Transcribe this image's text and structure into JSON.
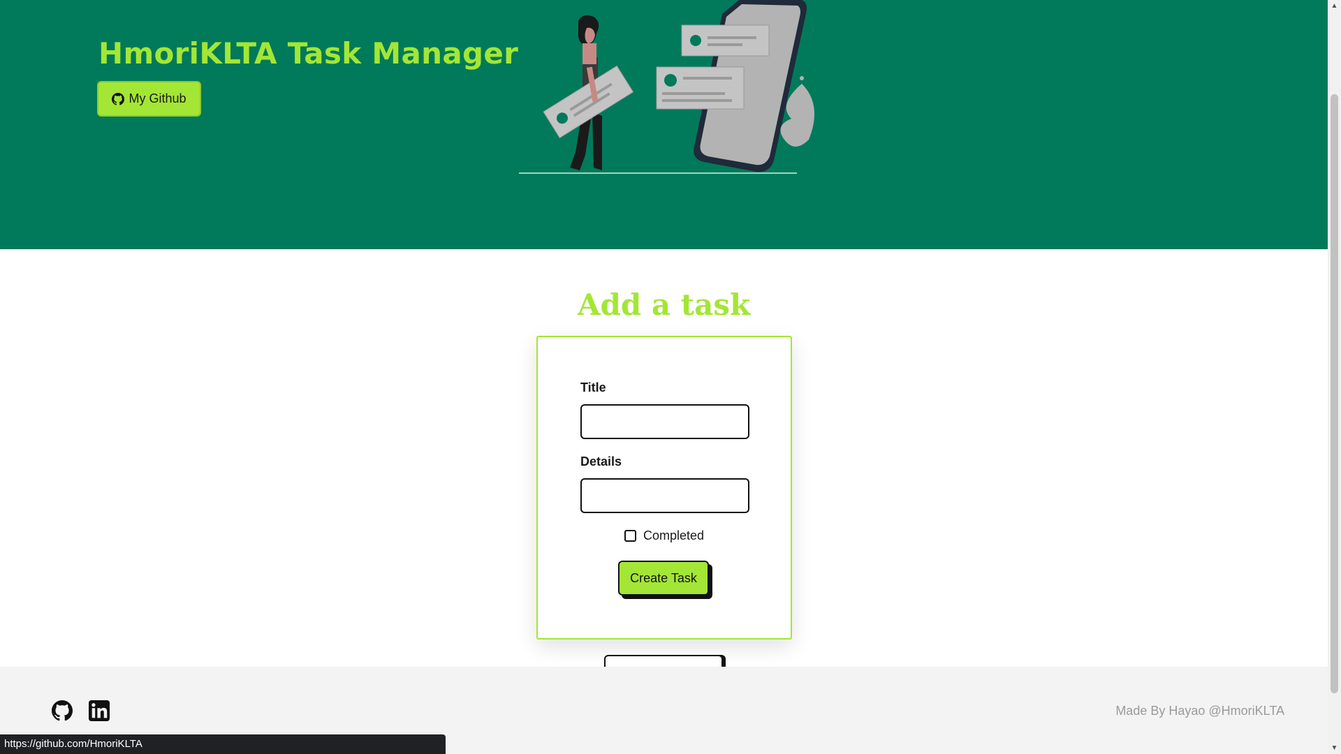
{
  "header": {
    "title": "HmoriKLTA Task Manager",
    "github_button_label": "My Github"
  },
  "form": {
    "section_title": "Add a task",
    "title_label": "Title",
    "title_value": "",
    "details_label": "Details",
    "details_value": "",
    "completed_label": "Completed",
    "completed_checked": false,
    "submit_label": "Create Task"
  },
  "footer": {
    "icons": [
      "github-icon",
      "linkedin-icon"
    ],
    "credit": "Made By Hayao @HmoriKLTA"
  },
  "status_bar": {
    "url": "https://github.com/HmoriKLTA"
  },
  "colors": {
    "hero_bg": "#007a5a",
    "accent": "#a3e635",
    "footer_bg": "#f3f3f3"
  }
}
